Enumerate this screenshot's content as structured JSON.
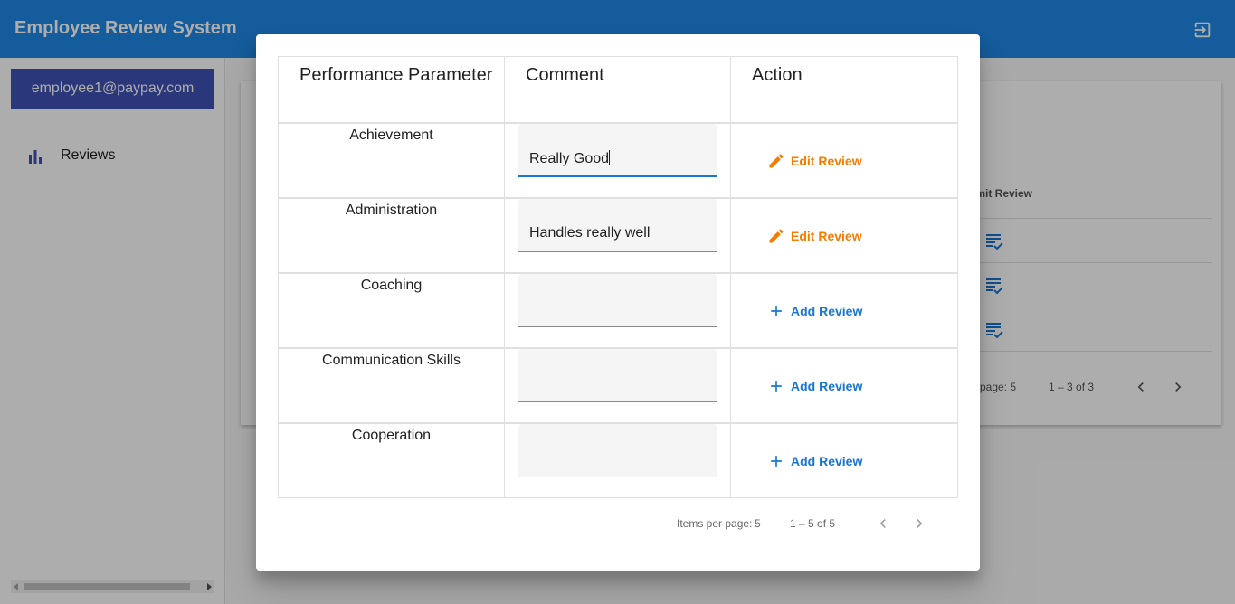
{
  "app": {
    "title": "Employee Review System",
    "colors": {
      "toolbar": "#1e88e5",
      "user_chip": "#3f51b5",
      "edit": "#f57c00",
      "add": "#1976d2"
    }
  },
  "sidebar": {
    "user_email": "employee1@paypay.com",
    "nav": [
      {
        "label": "Reviews",
        "icon": "bar-chart-icon"
      }
    ]
  },
  "background_table": {
    "column_header": "bmit Review",
    "rows": 3,
    "row_icon": "rate-review-icon",
    "paginator": {
      "items_per_page": "page: 5",
      "range": "1 – 3 of 3"
    }
  },
  "dialog": {
    "headers": {
      "parameter": "Performance Parameter",
      "comment": "Comment",
      "action": "Action"
    },
    "rows": [
      {
        "parameter": "Achievement",
        "comment": "Really Good",
        "action": "Edit Review"
      },
      {
        "parameter": "Administration",
        "comment": "Handles really well",
        "action": "Edit Review"
      },
      {
        "parameter": "Coaching",
        "comment": "",
        "action": "Add Review"
      },
      {
        "parameter": "Communication Skills",
        "comment": "",
        "action": "Add Review"
      },
      {
        "parameter": "Cooperation",
        "comment": "",
        "action": "Add Review"
      }
    ],
    "paginator": {
      "items_per_page_label": "Items per page:",
      "items_per_page_value": "5",
      "range": "1 – 5 of 5"
    }
  }
}
